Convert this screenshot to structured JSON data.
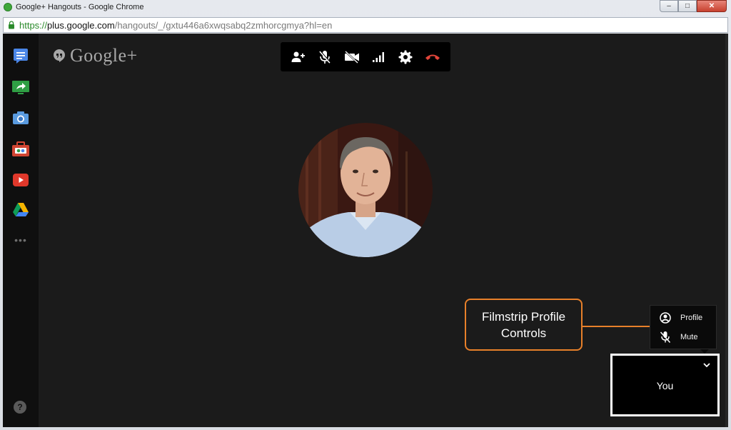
{
  "window": {
    "title": "Google+ Hangouts - Google Chrome",
    "controls": {
      "minimize": "‒",
      "maximize": "□",
      "close": "✕"
    }
  },
  "address": {
    "scheme": "https://",
    "host": "plus.google.com",
    "path": "/hangouts/_/gxtu446a6xwqsabq2zmhorcgmya?hl=en"
  },
  "sidebar": {
    "apps": [
      {
        "name": "chat-icon",
        "color": "#4a86e8"
      },
      {
        "name": "screenshare-icon",
        "color": "#2f9e44"
      },
      {
        "name": "camera-icon",
        "color": "#5a9be0"
      },
      {
        "name": "toolbox-icon",
        "color": "#d04533"
      },
      {
        "name": "youtube-icon",
        "color": "#e0382b"
      },
      {
        "name": "drive-icon",
        "color": "#f4b400"
      }
    ],
    "more": "•••",
    "help": "?"
  },
  "brand": {
    "logo_text": "Google+"
  },
  "toolbar": {
    "icons": [
      "invite-people-icon",
      "mute-mic-icon",
      "camera-off-icon",
      "bandwidth-icon",
      "settings-icon",
      "hang-up-icon"
    ],
    "hangup_color": "#e2453a"
  },
  "callout": {
    "line1": "Filmstrip Profile",
    "line2": "Controls"
  },
  "menu": {
    "profile": "Profile",
    "mute": "Mute"
  },
  "filmstrip": {
    "label": "You"
  },
  "colors": {
    "accent": "#e8802a",
    "background": "#1b1b1b"
  }
}
